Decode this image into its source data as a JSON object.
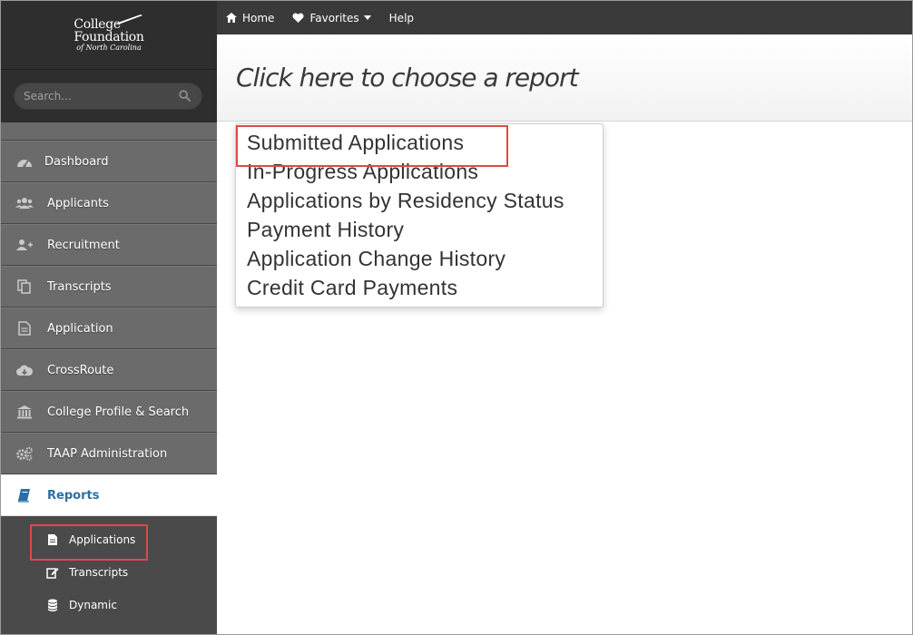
{
  "brand": {
    "line1": "College",
    "line2": "Foundation",
    "line3": "of North Carolina"
  },
  "search": {
    "placeholder": "Search..."
  },
  "topnav": {
    "home": "Home",
    "favorites": "Favorites",
    "help": "Help"
  },
  "sidebar": {
    "items": [
      {
        "label": "Dashboard",
        "icon": "dashboard-icon"
      },
      {
        "label": "Applicants",
        "icon": "users-icon"
      },
      {
        "label": "Recruitment",
        "icon": "user-plus-icon"
      },
      {
        "label": "Transcripts",
        "icon": "copy-icon"
      },
      {
        "label": "Application",
        "icon": "document-icon"
      },
      {
        "label": "CrossRoute",
        "icon": "cloud-download-icon"
      },
      {
        "label": "College Profile & Search",
        "icon": "bank-icon"
      },
      {
        "label": "TAAP Administration",
        "icon": "cogs-icon"
      },
      {
        "label": "Reports",
        "icon": "book-icon",
        "active": true
      }
    ],
    "reports_sub": [
      {
        "label": "Applications",
        "icon": "document-icon",
        "highlighted": true
      },
      {
        "label": "Transcripts",
        "icon": "edit-icon"
      },
      {
        "label": "Dynamic",
        "icon": "database-icon"
      }
    ]
  },
  "main": {
    "title": "Click here to choose a report",
    "report_options": [
      "Submitted Applications",
      "In-Progress Applications",
      "Applications by Residency Status",
      "Payment History",
      "Application Change History",
      "Credit Card Payments"
    ]
  },
  "colors": {
    "accent": "#2a6fa3",
    "highlight_box": "#e04848",
    "sidebar_bg": "#6b6b6b",
    "topbar_bg": "#3a3a3a"
  }
}
